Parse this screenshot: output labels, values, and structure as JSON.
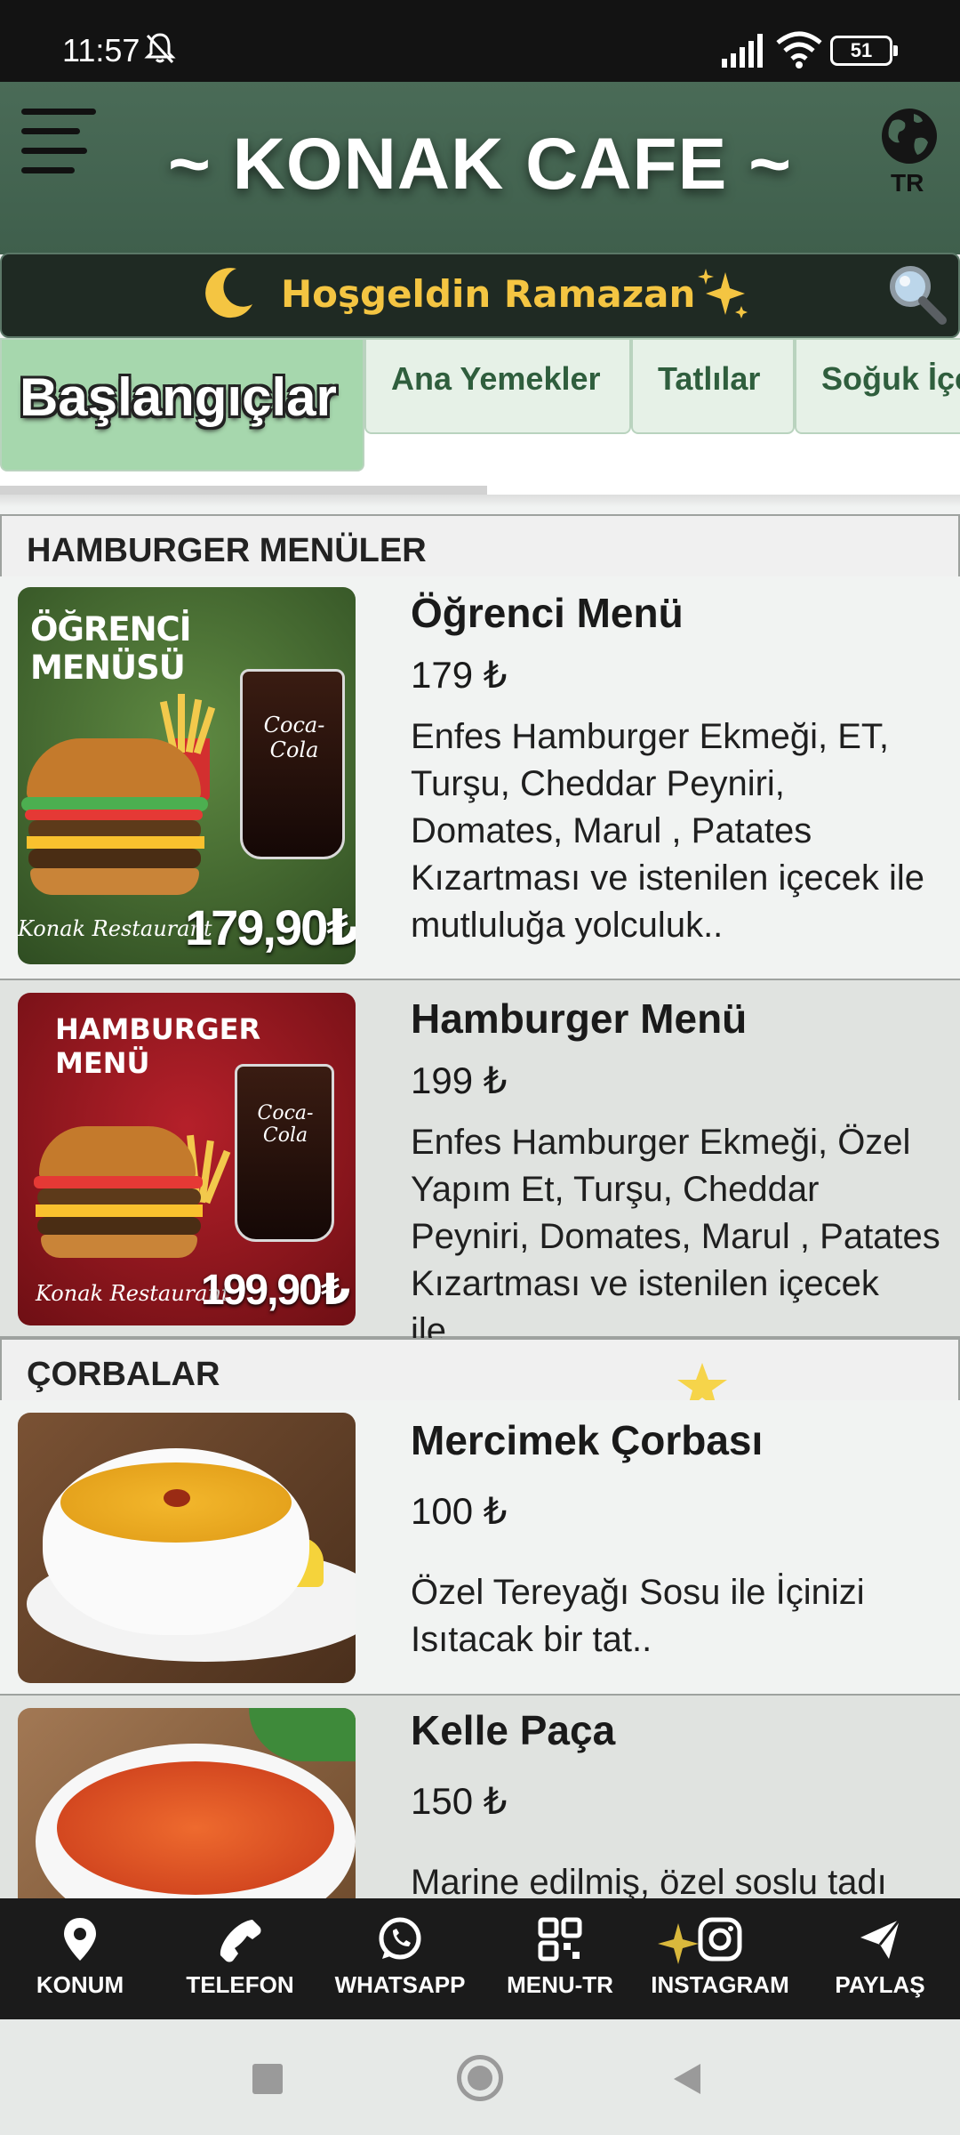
{
  "status_bar": {
    "time": "11:57",
    "battery": "51"
  },
  "header": {
    "title": "~ KONAK CAFE ~",
    "language": "TR"
  },
  "banner": {
    "text": "Hoşgeldin Ramazan"
  },
  "tabs": [
    {
      "label": "Başlangıçlar"
    },
    {
      "label": "Ana Yemekler"
    },
    {
      "label": "Tatlılar"
    },
    {
      "label": "Soğuk İçe"
    }
  ],
  "sections": [
    {
      "title": "HAMBURGER MENÜLER",
      "items": [
        {
          "name": "Öğrenci Menü",
          "price": "179 ₺",
          "description": "Enfes Hamburger Ekmeği, ET, Turşu, Cheddar Peyniri, Domates, Marul , Patates Kızartması ve istenilen içecek ile mutluluğa yolculuk..",
          "image_title": "ÖĞRENCİ MENÜSÜ",
          "image_price": "179,90₺",
          "image_brand": "Konak Restaurant",
          "image_logo": "Coca-Cola"
        },
        {
          "name": "Hamburger Menü",
          "price": "199 ₺",
          "description": "Enfes Hamburger Ekmeği, Özel Yapım Et, Turşu, Cheddar Peyniri, Domates, Marul , Patates Kızartması ve istenilen içecek ile..",
          "image_title": "HAMBURGER MENÜ",
          "image_price": "199,90₺",
          "image_brand": "Konak Restaurant",
          "image_logo": "Coca-Cola"
        }
      ]
    },
    {
      "title": "ÇORBALAR",
      "items": [
        {
          "name": "Mercimek Çorbası",
          "price": "100 ₺",
          "description": "Özel Tereyağı Sosu ile İçinizi Isıtacak bir tat.."
        },
        {
          "name": "Kelle Paça",
          "price": "150 ₺",
          "description": "Marine edilmiş, özel soslu tadı"
        }
      ]
    }
  ],
  "bottom_nav": [
    {
      "label": "KONUM",
      "icon": "location-pin-icon"
    },
    {
      "label": "TELEFON",
      "icon": "phone-icon"
    },
    {
      "label": "WHATSAPP",
      "icon": "whatsapp-icon"
    },
    {
      "label": "MENU-TR",
      "icon": "qr-code-icon"
    },
    {
      "label": "INSTAGRAM",
      "icon": "instagram-icon"
    },
    {
      "label": "PAYLAŞ",
      "icon": "share-icon"
    }
  ],
  "colors": {
    "header_green": "#46664f",
    "banner_text": "#f4c542",
    "active_tab": "#a6d7ad",
    "tab_text": "#2f5e3d",
    "bottom_nav_bg": "#1b1b1b"
  }
}
